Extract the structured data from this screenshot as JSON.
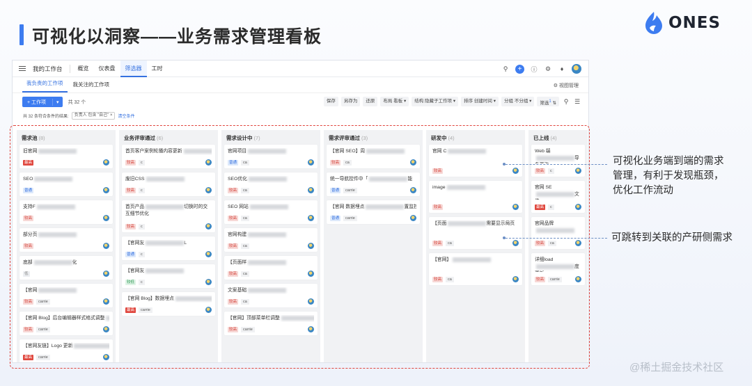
{
  "slide": {
    "title": "可视化以洞察——业务需求管理看板",
    "brand": "ONES",
    "brand_color": "#3d7cf0",
    "watermark": "@稀土掘金技术社区"
  },
  "app": {
    "topnav": {
      "workspace": "我的工作台",
      "tabs": [
        "概览",
        "仪表盘",
        "筛选器",
        "工时"
      ],
      "active_tab": "筛选器"
    },
    "subtabs": [
      "我负责的工作项",
      "我关注的工作项"
    ],
    "view_manage": "视图管理",
    "toolbar": {
      "create": "+ 工作项",
      "count": "共 32 个",
      "save": "保存",
      "save_as": "另存为",
      "restore": "还原",
      "layout_label": "布局",
      "layout_value": "看板",
      "structure_label": "结构",
      "structure_value": "隐藏子工作项",
      "sort_label": "排序",
      "sort_value": "创建时间",
      "group_label": "分组",
      "group_value": "不分组",
      "filter": "筛选",
      "filter_badge": "1"
    },
    "filter_line": {
      "text": "共 32 条符合条件的结果:",
      "tag": "负责人 包含 \"自己\" ×",
      "link": "清空条件"
    }
  },
  "columns": [
    {
      "name": "需求池",
      "count": "(8)",
      "cards": [
        {
          "title": "旧官网",
          "tag": "solidred",
          "tag_text": "最高",
          "owner": ""
        },
        {
          "title": "SEO",
          "tag": "blue",
          "tag_text": "普通",
          "owner": ""
        },
        {
          "title": "支持F",
          "tag": "red",
          "tag_text": "较高",
          "owner": ""
        },
        {
          "title": "部分页",
          "tag": "red",
          "tag_text": "较高",
          "owner": ""
        },
        {
          "title": "底部",
          "title_end": "化",
          "tag": "gray",
          "tag_text": "低",
          "owner": ""
        },
        {
          "title": "【官网",
          "tag": "red",
          "tag_text": "较高",
          "owner": "carrie"
        },
        {
          "title": "【官网 Blog】后台编辑器样式格式调整",
          "tag": "red",
          "tag_text": "较高",
          "owner": "carrie"
        },
        {
          "title": "【官网友链】Logo 更新",
          "tag": "solidred",
          "tag_text": "最高",
          "owner": "carrie"
        }
      ]
    },
    {
      "name": "业务评审通过",
      "count": "(6)",
      "cards": [
        {
          "title": "首页客户案例轮播内容更新",
          "tag": "red",
          "tag_text": "较高",
          "owner": "c",
          "tall": false
        },
        {
          "title": "废旧CSS",
          "tag": "red",
          "tag_text": "较高",
          "owner": "c"
        },
        {
          "title": "首页产品",
          "title_end": "切换时的交互细节优化",
          "tag": "red",
          "tag_text": "较高",
          "owner": "c",
          "tall": true
        },
        {
          "title": "【官网友",
          "title_end": "L",
          "tag": "blue",
          "tag_text": "普通",
          "owner": "c"
        },
        {
          "title": "【官网友",
          "tag": "green",
          "tag_text": "较低",
          "owner": "c"
        },
        {
          "title": "【官网 Blog】数据埋点",
          "tag": "solidred",
          "tag_text": "最高",
          "owner": "carrie"
        }
      ]
    },
    {
      "name": "需求设计中",
      "count": "(7)",
      "cards": [
        {
          "title": "官网项目",
          "tag": "blue",
          "tag_text": "普通",
          "owner": "ca"
        },
        {
          "title": "SEO优化",
          "tag": "red",
          "tag_text": "较高",
          "owner": "ca"
        },
        {
          "title": "SEO 网站",
          "tag": "red",
          "tag_text": "较高",
          "owner": "ca"
        },
        {
          "title": "官网构建",
          "tag": "red",
          "tag_text": "较高",
          "owner": "ca"
        },
        {
          "title": "【页面样",
          "tag": "red",
          "tag_text": "较高",
          "owner": "ca"
        },
        {
          "title": "文案基础",
          "tag": "red",
          "tag_text": "较高",
          "owner": "ca"
        },
        {
          "title": "【官网】顶部菜单栏调整",
          "tag": "red",
          "tag_text": "较高",
          "owner": "carrie"
        }
      ]
    },
    {
      "name": "需求评审通过",
      "count": "(3)",
      "cards": [
        {
          "title": "【官网 SEO】周",
          "tag": "red",
          "tag_text": "较高",
          "owner": "ca"
        },
        {
          "title": "统一导航控件中「",
          "title_end": "能",
          "tag": "blue",
          "tag_text": "普通",
          "owner": "carrie"
        },
        {
          "title": "【官网 数据埋点",
          "title_end": "置监控",
          "tag": "blue",
          "tag_text": "普通",
          "owner": "carrie"
        }
      ]
    },
    {
      "name": "研发中",
      "count": "(4)",
      "cards": [
        {
          "title": "官网 C",
          "tag": "red",
          "tag_text": "较高",
          "owner": "",
          "tall": true
        },
        {
          "title": "image",
          "tag": "red",
          "tag_text": "较高",
          "owner": "",
          "tall": true
        },
        {
          "title": "【页面",
          "title_end": "需要显示局页",
          "tag": "red",
          "tag_text": "较高",
          "owner": "ca",
          "tall": true
        },
        {
          "title": "【官网】",
          "tag": "red",
          "tag_text": "较高",
          "owner": "ca",
          "tall": true
        }
      ]
    },
    {
      "name": "已上线",
      "count": "(4)",
      "narrow": true,
      "cards": [
        {
          "title": "Web 端",
          "title_end": "导条更改",
          "tag": "red",
          "tag_text": "较高",
          "owner": "c",
          "tall": true
        },
        {
          "title": "官网 SE",
          "title_end": "文件",
          "tag": "solidred",
          "tag_text": "最高",
          "owner": "c",
          "tall": true
        },
        {
          "title": "官网品牌",
          "tag": "red",
          "tag_text": "较高",
          "owner": "ca",
          "tall": true
        },
        {
          "title": "详细load",
          "title_end": "度更新",
          "tag": "red",
          "tag_text": "较高",
          "owner": "carrie",
          "tall": true
        }
      ]
    }
  ],
  "callouts": [
    "可视化业务端到端的需求管理，有利于发现瓶颈，优化工作流动",
    "可跳转到关联的产研侧需求"
  ],
  "callout_lines": [
    "可视化业务端到端的需求",
    "管理，有利于发现瓶颈，",
    "优化工作流动"
  ]
}
